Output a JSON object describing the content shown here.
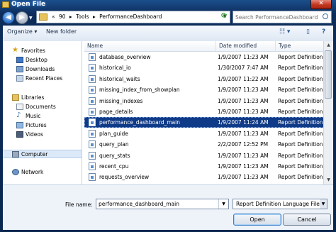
{
  "window": {
    "title": "Open File",
    "close_label": "✕"
  },
  "address": {
    "recent_dropdown": "▼",
    "crumbs": [
      "«",
      "90",
      "▸",
      "Tools",
      "▸",
      "PerformanceDashboard"
    ],
    "dropdown": "▼",
    "refresh_symbol": "⟳"
  },
  "search": {
    "placeholder": "Search PerformanceDashboard"
  },
  "toolbar": {
    "organize": "Organize ▾",
    "new_folder": "New folder",
    "views": "☷ ▾",
    "preview": "▯",
    "help": "?"
  },
  "nav": {
    "favorites": "Favorites",
    "desktop": "Desktop",
    "downloads": "Downloads",
    "recent_places": "Recent Places",
    "libraries": "Libraries",
    "documents": "Documents",
    "music": "Music",
    "pictures": "Pictures",
    "videos": "Videos",
    "computer": "Computer",
    "network": "Network"
  },
  "columns": {
    "name": "Name",
    "date_modified": "Date modified",
    "type": "Type"
  },
  "files": [
    {
      "name": "database_overview",
      "date": "1/9/2007 11:23 AM",
      "type": "Report Definition File"
    },
    {
      "name": "historical_io",
      "date": "1/30/2007 7:47 AM",
      "type": "Report Definition File"
    },
    {
      "name": "historical_waits",
      "date": "1/9/2007 11:22 AM",
      "type": "Report Definition File"
    },
    {
      "name": "missing_index_from_showplan",
      "date": "1/9/2007 11:23 AM",
      "type": "Report Definition File"
    },
    {
      "name": "missing_indexes",
      "date": "1/9/2007 11:23 AM",
      "type": "Report Definition File"
    },
    {
      "name": "page_details",
      "date": "1/9/2007 11:23 AM",
      "type": "Report Definition File"
    },
    {
      "name": "performance_dashboard_main",
      "date": "1/9/2007 11:24 AM",
      "type": "Report Definition File",
      "selected": true
    },
    {
      "name": "plan_guide",
      "date": "1/9/2007 11:23 AM",
      "type": "Report Definition File"
    },
    {
      "name": "query_plan",
      "date": "2/2/2007 12:52 PM",
      "type": "Report Definition File"
    },
    {
      "name": "query_stats",
      "date": "1/9/2007 11:23 AM",
      "type": "Report Definition File"
    },
    {
      "name": "recent_cpu",
      "date": "1/9/2007 11:23 AM",
      "type": "Report Definition File"
    },
    {
      "name": "requests_overview",
      "date": "1/9/2007 11:23 AM",
      "type": "Report Definition File"
    }
  ],
  "bottom": {
    "file_name_label": "File name:",
    "file_name_value": "performance_dashboard_main",
    "file_type_value": "Report Definition Language File",
    "open_label": "Open",
    "cancel_label": "Cancel"
  },
  "colors": {
    "selection": "#0f3a87",
    "title_bar": "#0c2c5a"
  }
}
